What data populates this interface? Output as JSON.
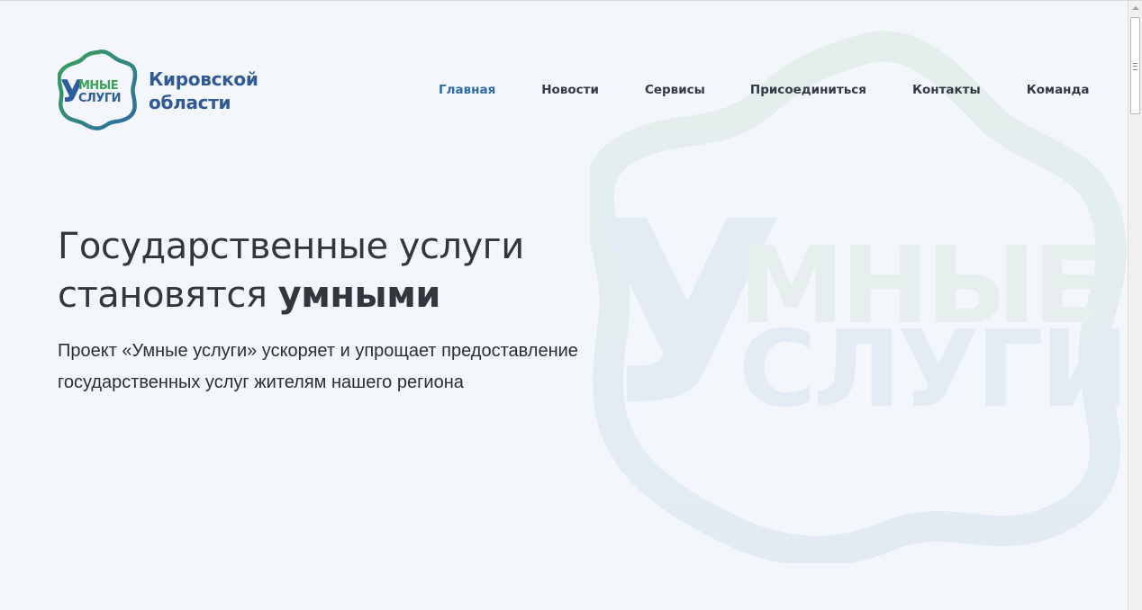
{
  "header": {
    "logo_alt_text": "Умные услуги",
    "region_name_line1": "Кировской",
    "region_name_line2": "области"
  },
  "nav": {
    "items": [
      {
        "label": "Главная",
        "active": true
      },
      {
        "label": "Новости",
        "active": false
      },
      {
        "label": "Сервисы",
        "active": false
      },
      {
        "label": "Присоединиться",
        "active": false
      },
      {
        "label": "Контакты",
        "active": false
      },
      {
        "label": "Команда",
        "active": false
      }
    ]
  },
  "hero": {
    "title_part1": "Государственные услуги",
    "title_part2": "становятся ",
    "title_bold": "умными",
    "description": "Проект «Умные услуги» ускоряет и упрощает предоставление государственных услуг жителям нашего региона"
  },
  "colors": {
    "brand_blue": "#2f5a93",
    "brand_green": "#3aa356",
    "active_nav": "#2f6ba3",
    "background": "#f3f7fc"
  }
}
